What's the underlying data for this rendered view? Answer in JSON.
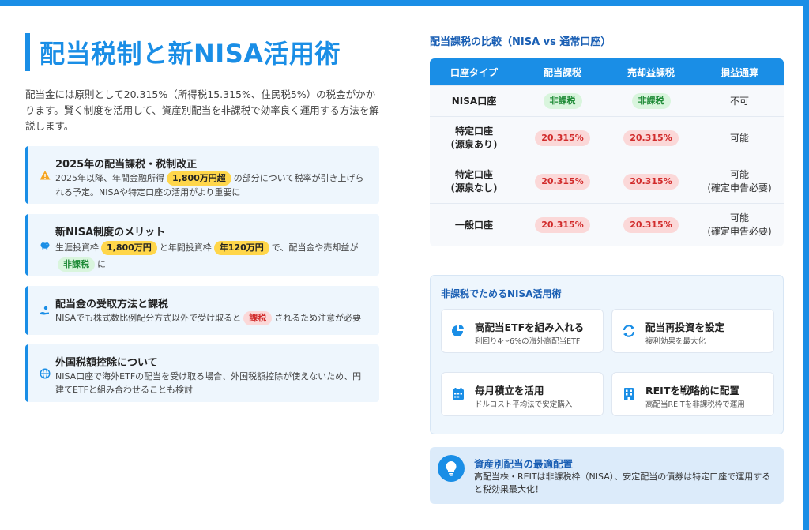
{
  "title": "配当税制と新NISA活用術",
  "intro": "配当金には原則として20.315%（所得税15.315%、住民税5%）の税金がかかります。賢く制度を活用して、資産別配当を非課税で効率良く運用する方法を解説します。",
  "cards": [
    {
      "icon": "warning-icon",
      "title": "2025年の配当課税・税制改正",
      "text_1": "2025年以降、年間金融所得",
      "highlight_1": "1,800万円超",
      "text_2": "の部分について税率が引き上げられる予定。NISAや特定口座の活用がより重要に"
    },
    {
      "icon": "piggy-bank-icon",
      "title": "新NISA制度のメリット",
      "text_1": "生涯投資枠",
      "highlight_1": "1,800万円",
      "text_2": "と年間投資枠",
      "highlight_2": "年120万円",
      "text_3": "で、配当金や売却益が",
      "badge": "非課税",
      "text_4": "に"
    },
    {
      "icon": "hand-coin-icon",
      "title": "配当金の受取方法と課税",
      "text_1": "NISAでも株式数比例配分方式以外で受け取ると",
      "badge": "課税",
      "text_2": "されるため注意が必要"
    },
    {
      "icon": "globe-icon",
      "title": "外国税額控除について",
      "text_1": "NISA口座で海外ETFの配当を受け取る場合、外国税額控除が使えないため、円建てETFと組み合わせることも検討"
    }
  ],
  "comparison": {
    "title": "配当課税の比較（NISA vs 通常口座）",
    "headers": [
      "口座タイプ",
      "配当課税",
      "売却益課税",
      "損益通算"
    ],
    "rows": [
      {
        "type": "NISA口座",
        "type2": "",
        "dividend": "非課税",
        "gain": "非課税",
        "offset": "不可",
        "offset2": ""
      },
      {
        "type": "特定口座",
        "type2": "(源泉あり)",
        "dividend": "20.315%",
        "gain": "20.315%",
        "offset": "可能",
        "offset2": ""
      },
      {
        "type": "特定口座",
        "type2": "(源泉なし)",
        "dividend": "20.315%",
        "gain": "20.315%",
        "offset": "可能",
        "offset2": "(確定申告必要)"
      },
      {
        "type": "一般口座",
        "type2": "",
        "dividend": "20.315%",
        "gain": "20.315%",
        "offset": "可能",
        "offset2": "(確定申告必要)"
      }
    ]
  },
  "tips": {
    "title": "非課税でためるNISA活用術",
    "items": [
      {
        "icon": "pie-chart-icon",
        "title": "高配当ETFを組み入れる",
        "sub": "利回り4〜6%の海外高配当ETF"
      },
      {
        "icon": "refresh-icon",
        "title": "配当再投資を設定",
        "sub": "複利効果を最大化"
      },
      {
        "icon": "calendar-icon",
        "title": "毎月積立を活用",
        "sub": "ドルコスト平均法で安定購入"
      },
      {
        "icon": "building-icon",
        "title": "REITを戦略的に配置",
        "sub": "高配当REITを非課税枠で運用"
      }
    ]
  },
  "best": {
    "icon": "lightbulb-icon",
    "title": "資産別配当の最適配置",
    "text": "高配当株・REITは非課税枠（NISA）、安定配当の債券は特定口座で運用すると税効果最大化！"
  },
  "colors": {
    "accent": "#1a8ee6",
    "highlight": "#ffd64a",
    "tax_free": "#1d8a35",
    "taxed": "#d12b2b"
  }
}
